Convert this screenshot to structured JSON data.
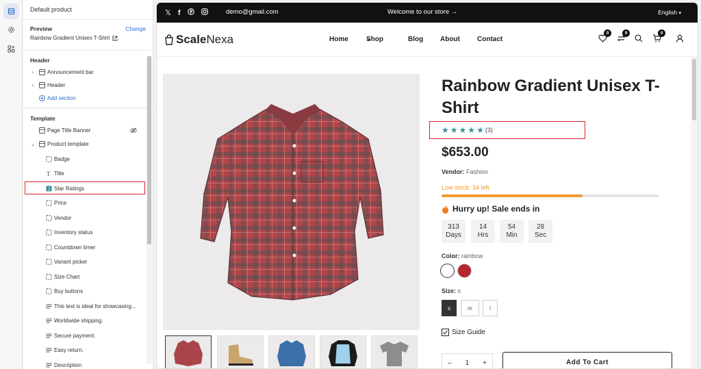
{
  "sidebar": {
    "title": "Default product",
    "preview_heading": "Preview",
    "change_label": "Change",
    "preview_product": "Rainbow Gradient Unisex T-Shirt",
    "header_group": {
      "heading": "Header",
      "items": [
        "Announcement bar",
        "Header"
      ],
      "add_section": "Add section"
    },
    "template_group": {
      "heading": "Template",
      "page_title_banner": "Page Title Banner",
      "product_template": "Product template",
      "blocks": [
        "Badge",
        "Title",
        "Star Ratings",
        "Price",
        "Vendor",
        "Inventory status",
        "Countdown timer",
        "Variant picker",
        "Size Chart",
        "Buy buttons",
        "This text is ideal for showcasing...",
        "Worldwide shipping.",
        "Secure payment.",
        "Easy return.",
        "Description"
      ],
      "highlighted_block": "Star Ratings"
    }
  },
  "store": {
    "topbar": {
      "email": "demo@gmail.com",
      "welcome": "Welcome to our store",
      "language": "English"
    },
    "logo": {
      "part1": "Scale",
      "part2": "Nexa"
    },
    "menu": [
      "Home",
      "Shop",
      "Blog",
      "About",
      "Contact"
    ],
    "wishlist_count": "0",
    "compare_count": "0",
    "cart_count": "0"
  },
  "product": {
    "title": "Rainbow Gradient Unisex T-Shirt",
    "review_count": "(3)",
    "rating": 5,
    "price": "$653.00",
    "vendor_label": "Vendor:",
    "vendor": "Fashion",
    "stock_text": "Low stock: 34 left",
    "stock_fraction": 0.65,
    "hurry_text": "Hurry up! Sale ends in",
    "countdown": [
      {
        "value": "313",
        "unit": "Days"
      },
      {
        "value": "14",
        "unit": "Hrs"
      },
      {
        "value": "54",
        "unit": "Min"
      },
      {
        "value": "28",
        "unit": "Sec"
      }
    ],
    "color_label": "Color:",
    "color_value": "rainbow",
    "size_label": "Size:",
    "size_value": "s",
    "sizes": [
      "s",
      "m",
      "l"
    ],
    "size_guide": "Size Guide",
    "quantity": "1",
    "add_to_cart": "Add To Cart"
  },
  "colors": {
    "accent": "#2c6ecb",
    "highlight": "#e0202a",
    "star": "#3a8f9a",
    "stock": "#f09a2a",
    "swatch_red": "#b3282f"
  }
}
